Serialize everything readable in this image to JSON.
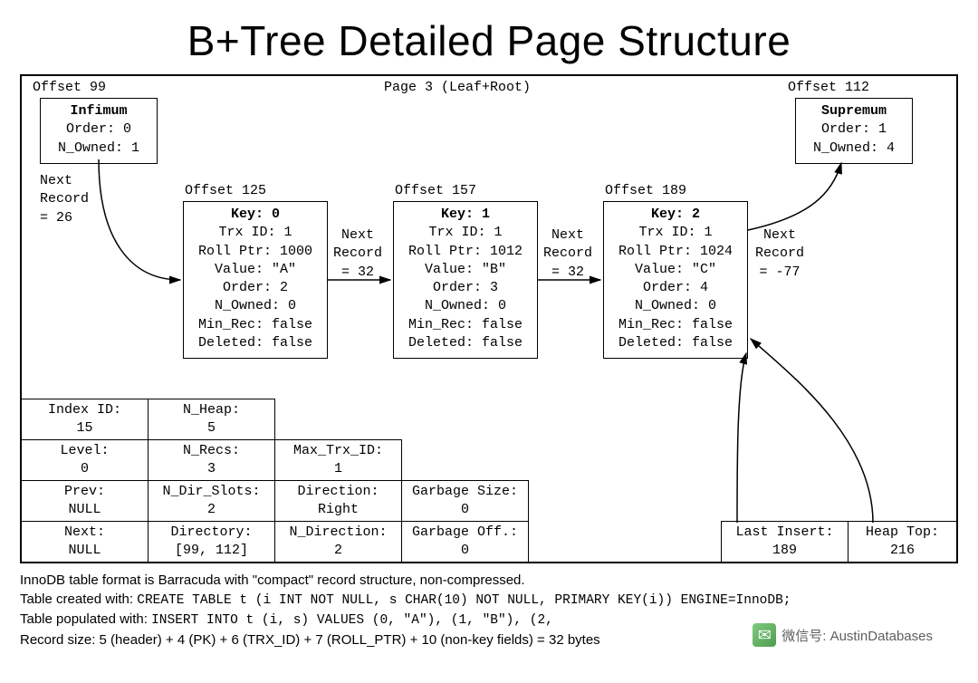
{
  "title": "B+Tree Detailed Page Structure",
  "pageHeader": "Page 3 (Leaf+Root)",
  "infimum": {
    "offsetLabel": "Offset 99",
    "head": "Infimum",
    "order": "Order: 0",
    "nowned": "N_Owned: 1"
  },
  "supremum": {
    "offsetLabel": "Offset 112",
    "head": "Supremum",
    "order": "Order: 1",
    "nowned": "N_Owned: 4"
  },
  "nextRec": {
    "inf": "Next\nRecord\n= 26",
    "k0": "Next\nRecord\n= 32",
    "k1": "Next\nRecord\n= 32",
    "k2": "Next\nRecord\n= -77"
  },
  "records": [
    {
      "offsetLabel": "Offset 125",
      "head": "Key: 0",
      "lines": [
        "Trx ID: 1",
        "Roll Ptr: 1000",
        "Value: \"A\"",
        "Order: 2",
        "N_Owned: 0",
        "Min_Rec: false",
        "Deleted: false"
      ]
    },
    {
      "offsetLabel": "Offset 157",
      "head": "Key: 1",
      "lines": [
        "Trx ID: 1",
        "Roll Ptr: 1012",
        "Value: \"B\"",
        "Order: 3",
        "N_Owned: 0",
        "Min_Rec: false",
        "Deleted: false"
      ]
    },
    {
      "offsetLabel": "Offset 189",
      "head": "Key: 2",
      "lines": [
        "Trx ID: 1",
        "Roll Ptr: 1024",
        "Value: \"C\"",
        "Order: 4",
        "N_Owned: 0",
        "Min_Rec: false",
        "Deleted: false"
      ]
    }
  ],
  "meta": {
    "indexId": {
      "l": "Index ID:",
      "v": "15"
    },
    "level": {
      "l": "Level:",
      "v": "0"
    },
    "prev": {
      "l": "Prev:",
      "v": "NULL"
    },
    "next": {
      "l": "Next:",
      "v": "NULL"
    },
    "nheap": {
      "l": "N_Heap:",
      "v": "5"
    },
    "nrecs": {
      "l": "N_Recs:",
      "v": "3"
    },
    "ndirslots": {
      "l": "N_Dir_Slots:",
      "v": "2"
    },
    "directory": {
      "l": "Directory:",
      "v": "[99, 112]"
    },
    "maxtrx": {
      "l": "Max_Trx_ID:",
      "v": "1"
    },
    "direction": {
      "l": "Direction:",
      "v": "Right"
    },
    "ndirection": {
      "l": "N_Direction:",
      "v": "2"
    },
    "gsize": {
      "l": "Garbage Size:",
      "v": "0"
    },
    "goff": {
      "l": "Garbage Off.:",
      "v": "0"
    },
    "lastinsert": {
      "l": "Last Insert:",
      "v": "189"
    },
    "heaptop": {
      "l": "Heap Top:",
      "v": "216"
    }
  },
  "caption": {
    "l1": "InnoDB table format is Barracuda with \"compact\" record structure, non-compressed.",
    "l2a": "Table created with: ",
    "l2b": "CREATE TABLE t (i INT NOT NULL, s CHAR(10) NOT NULL, PRIMARY KEY(i)) ENGINE=InnoDB;",
    "l3a": "Table populated with: ",
    "l3b": "INSERT INTO t (i, s) VALUES (0, \"A\"), (1, \"B\"), (2, ",
    "l4": "Record size: 5 (header) + 4 (PK) + 6 (TRX_ID) + 7 (ROLL_PTR) + 10 (non-key fields) = 32 bytes"
  },
  "watermark": "微信号: AustinDatabases"
}
